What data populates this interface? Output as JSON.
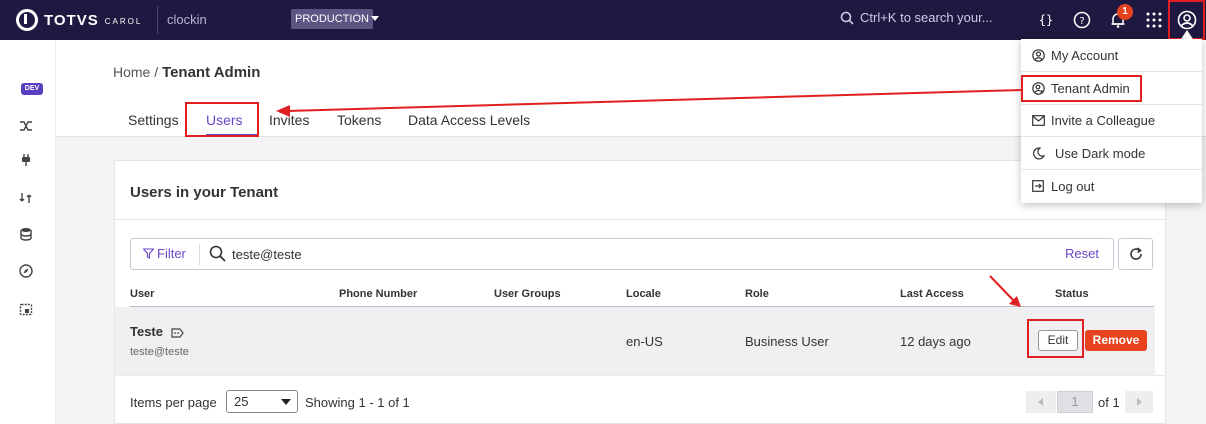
{
  "topbar": {
    "brand": "TOTVS",
    "brand_sub": "CAROL",
    "app_name": "clockin",
    "environment": "PRODUCTION",
    "search_placeholder": "Ctrl+K to search your...",
    "notifications_count": "1"
  },
  "sidenav": {
    "badge": "DEV",
    "items": [
      "shuffle-icon",
      "plug-icon",
      "pipeline-icon",
      "database-icon",
      "compass-icon",
      "calendar-icon"
    ]
  },
  "breadcrumb": {
    "home": "Home",
    "separator": "/",
    "current": "Tenant Admin"
  },
  "tabs": [
    {
      "label": "Settings",
      "active": false
    },
    {
      "label": "Users",
      "active": true
    },
    {
      "label": "Invites",
      "active": false
    },
    {
      "label": "Tokens",
      "active": false
    },
    {
      "label": "Data Access Levels",
      "active": false
    }
  ],
  "card": {
    "title": "Users in your Tenant",
    "filter_label": "Filter",
    "filter_value": "teste@teste",
    "reset_label": "Reset"
  },
  "table": {
    "headers": [
      "User",
      "Phone Number",
      "User Groups",
      "Locale",
      "Role",
      "Last Access",
      "Status"
    ],
    "rows": [
      {
        "name": "Teste",
        "email": "teste@teste",
        "phone": "",
        "groups": "",
        "locale": "en-US",
        "role": "Business User",
        "last_access": "12 days ago",
        "edit_label": "Edit",
        "remove_label": "Remove"
      }
    ]
  },
  "pagination": {
    "items_per_page_label": "Items per page",
    "items_per_page": "25",
    "showing": "Showing 1 - 1 of 1",
    "page": "1",
    "of_label": "of 1"
  },
  "user_menu": {
    "items": [
      {
        "label": "My Account",
        "icon": "user-circle-icon"
      },
      {
        "label": "Tenant Admin",
        "icon": "user-gear-icon"
      },
      {
        "label": "Invite a Colleague",
        "icon": "envelope-icon"
      },
      {
        "label": "Use Dark mode",
        "icon": "moon-icon"
      },
      {
        "label": "Log out",
        "icon": "logout-icon"
      }
    ]
  },
  "colors": {
    "topbar": "#1f1840",
    "accent": "#6a47c9",
    "danger": "#e8431f",
    "annotation": "#e02020"
  }
}
